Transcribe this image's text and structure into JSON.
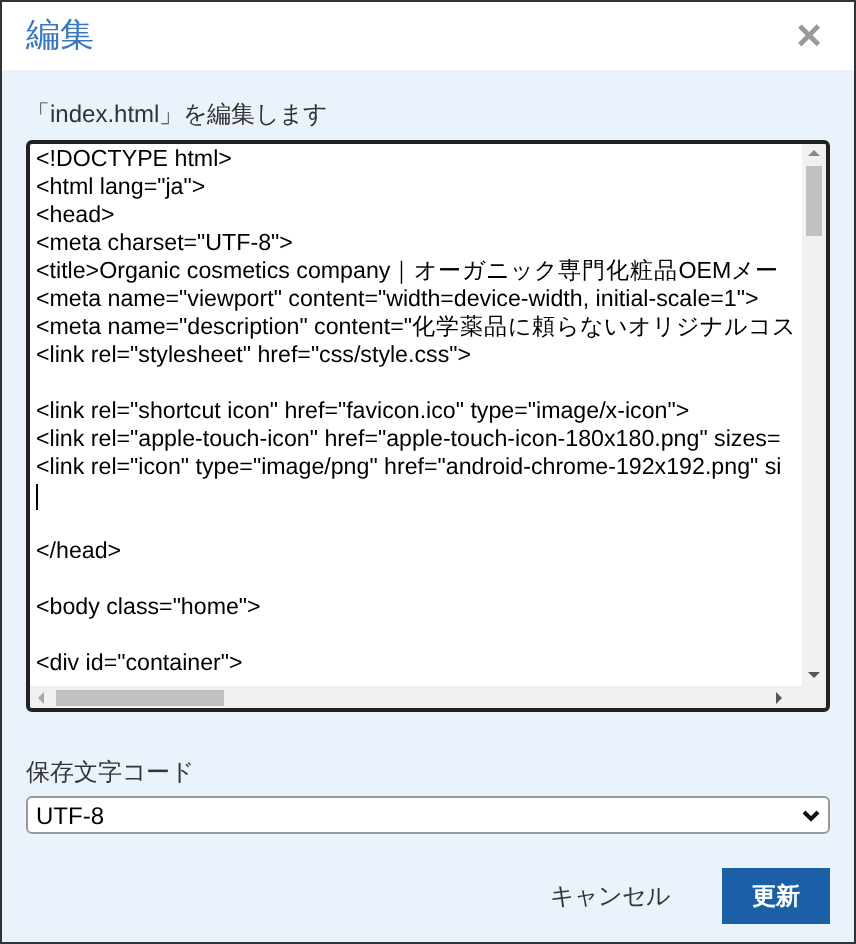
{
  "dialog": {
    "title": "編集",
    "close": "×"
  },
  "editor": {
    "label": "「index.html」を編集します",
    "lines": [
      {
        "kind": "code",
        "text": "<!DOCTYPE html>"
      },
      {
        "kind": "code",
        "text": "<html lang=\"ja\">"
      },
      {
        "kind": "code",
        "text": "<head>"
      },
      {
        "kind": "code",
        "text": "<meta charset=\"UTF-8\">"
      },
      {
        "kind": "code",
        "text": "<title>Organic cosmetics company｜オーガニック専門化粧品OEMメー"
      },
      {
        "kind": "code",
        "text": "<meta name=\"viewport\" content=\"width=device-width, initial-scale=1\">"
      },
      {
        "kind": "code",
        "text": "<meta name=\"description\" content=\"化学薬品に頼らないオリジナルコス"
      },
      {
        "kind": "code",
        "text": "<link rel=\"stylesheet\" href=\"css/style.css\">"
      },
      {
        "kind": "blank"
      },
      {
        "kind": "code",
        "text": "<link rel=\"shortcut icon\" href=\"favicon.ico\" type=\"image/x-icon\">"
      },
      {
        "kind": "code",
        "text": "<link rel=\"apple-touch-icon\" href=\"apple-touch-icon-180x180.png\" sizes="
      },
      {
        "kind": "code",
        "text": "<link rel=\"icon\" type=\"image/png\" href=\"android-chrome-192x192.png\" si"
      },
      {
        "kind": "cursor"
      },
      {
        "kind": "blank"
      },
      {
        "kind": "code",
        "text": "</head>"
      },
      {
        "kind": "blank"
      },
      {
        "kind": "code",
        "text": "<body class=\"home\">"
      },
      {
        "kind": "blank"
      },
      {
        "kind": "code",
        "text": "<div id=\"container\">"
      }
    ]
  },
  "encoding": {
    "label": "保存文字コード",
    "value": "UTF-8"
  },
  "buttons": [
    {
      "kind": "secondary",
      "label": "キャンセル"
    },
    {
      "kind": "primary",
      "label": "更新"
    }
  ]
}
